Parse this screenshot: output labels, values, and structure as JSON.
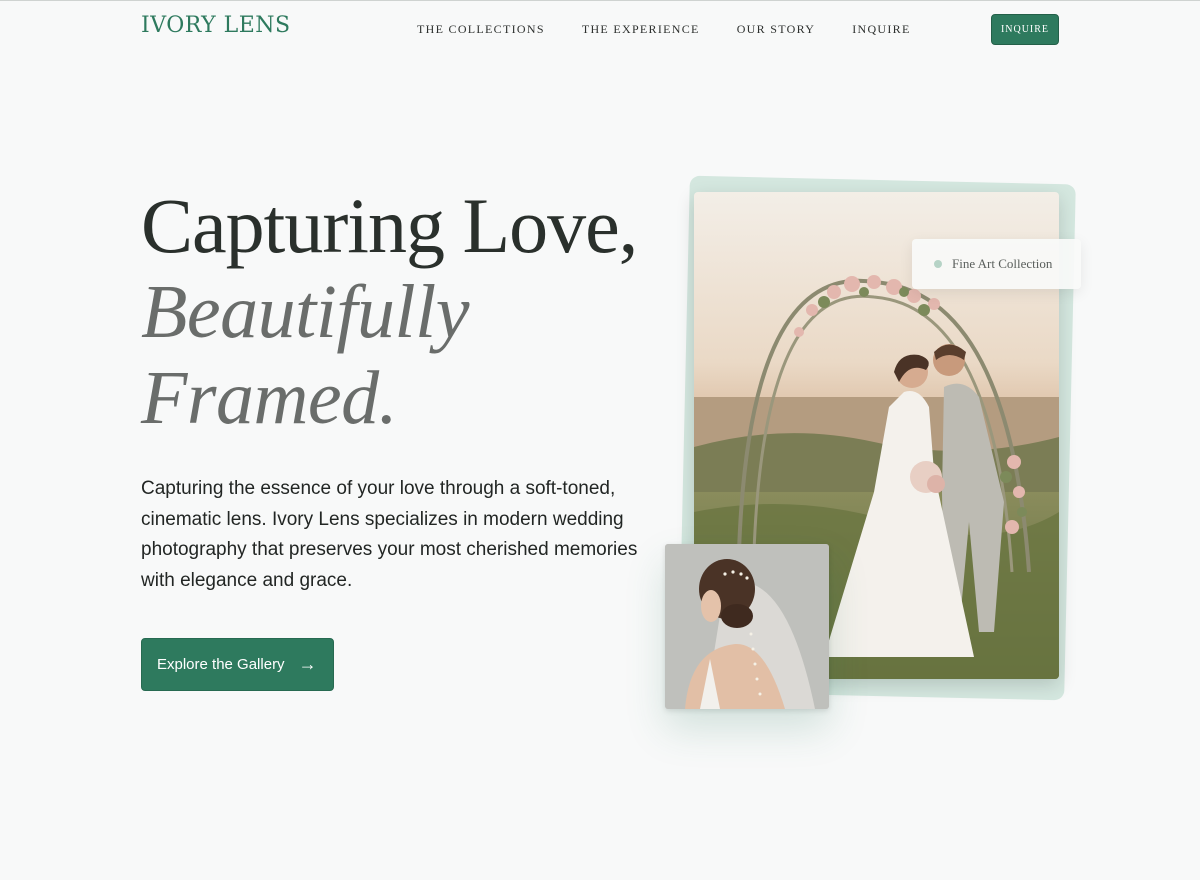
{
  "brand": {
    "logo": "IVORY LENS",
    "accent_color": "#2e7a5e"
  },
  "nav": {
    "links": [
      "THE COLLECTIONS",
      "THE EXPERIENCE",
      "OUR STORY",
      "INQUIRE"
    ],
    "cta_label": "INQUIRE"
  },
  "hero": {
    "headline_line1": "Capturing Love,",
    "headline_line2": "Beautifully",
    "headline_line3": "Framed.",
    "intro": "Capturing the essence of your love through a soft-toned, cinematic lens. Ivory Lens specializes in modern wedding photography that preserves your most cherished memories with elegance and grace.",
    "cta_label": "Explore the Gallery",
    "cta_icon": "arrow-right-icon"
  },
  "gallery": {
    "badge_label": "Fine Art Collection",
    "main_image": "wedding-couple-under-floral-arch-photo",
    "detail_image": "bride-veil-detail-photo"
  }
}
